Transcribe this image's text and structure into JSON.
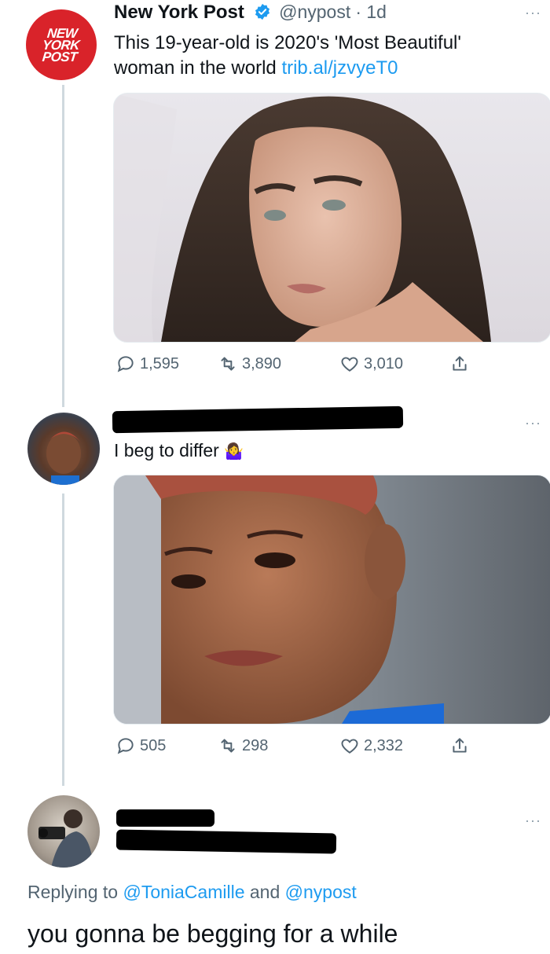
{
  "tweet1": {
    "name": "New York Post",
    "handle": "@nypost",
    "time": "· 1d",
    "logo_text": "NEW YORK POST",
    "text": "This 19-year-old is 2020's 'Most Beautiful' woman in the world",
    "text_line1": "This 19-year-old is 2020's 'Most Beautiful'",
    "text_line2_prefix": "woman in the world",
    "link": "trib.al/jzvyeT0",
    "replies": "1,595",
    "retweets": "3,890",
    "likes": "3,010"
  },
  "tweet2": {
    "text": "I beg to differ",
    "emoji": "🤷‍♀️",
    "replies": "505",
    "retweets": "298",
    "likes": "2,332"
  },
  "tweet3": {
    "replying_prefix": "Replying to",
    "mention1": "@ToniaCamille",
    "replying_and": "and",
    "mention2": "@nypost",
    "text": "you gonna be begging for a while"
  },
  "more_label": "···",
  "colors": {
    "accent": "#1d9bf0",
    "nypost_red": "#d9232a",
    "muted": "#536471"
  }
}
